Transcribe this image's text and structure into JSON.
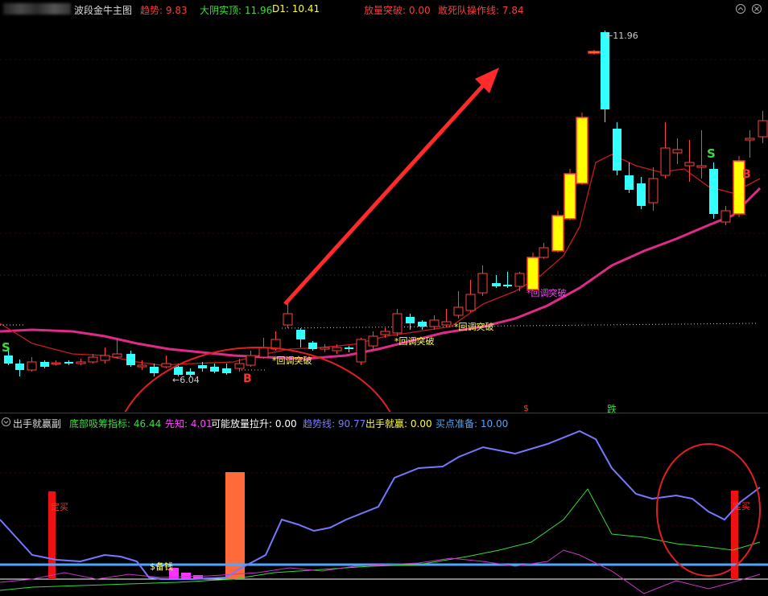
{
  "main_panel": {
    "title": "波段金牛主图",
    "indicators": [
      {
        "label": "趋势:",
        "value": "9.83",
        "color": "#ff3b3b"
      },
      {
        "label": "大阴实顶:",
        "value": "11.96",
        "color": "#3ddc3d"
      },
      {
        "label": "D1:",
        "value": "10.41",
        "color": "#ffff33"
      },
      {
        "label": "放量突破:",
        "value": "0.00",
        "color": "#ff3b3b"
      },
      {
        "label": "敢死队操作线:",
        "value": "7.84",
        "color": "#ff3b3b"
      }
    ],
    "annotations": {
      "high": "11.96",
      "low": "6.04",
      "breakout": "回调突破",
      "buy_b": "B",
      "sell_s": "S",
      "dollar": "$",
      "fall": "跌"
    }
  },
  "sub_panel": {
    "title": "出手就赢副",
    "indicators": [
      {
        "label": "底部吸筹指标:",
        "value": "46.44",
        "color": "#3ddc3d"
      },
      {
        "label": "先知:",
        "value": "4.01",
        "color": "#ff44ff"
      },
      {
        "label": "可能放量拉升:",
        "value": "0.00",
        "color": "#ffffff"
      },
      {
        "label": "趋势线:",
        "value": "90.77",
        "color": "#7a7aff"
      },
      {
        "label": "出手就赢:",
        "value": "0.00",
        "color": "#ffff33"
      },
      {
        "label": "买点准备:",
        "value": "10.00",
        "color": "#4da6ff"
      }
    ],
    "annotations": {
      "buy_left": "定买",
      "buy_right": "定买",
      "prepare_cash": "$备钱"
    }
  },
  "colors": {
    "background": "#000000",
    "up": "#ff4040",
    "down": "#33ffff",
    "ma_pink": "#e02a8a",
    "ma_red": "#d02020",
    "strong": "#ffff00",
    "arrow": "#ff2a2a"
  }
}
